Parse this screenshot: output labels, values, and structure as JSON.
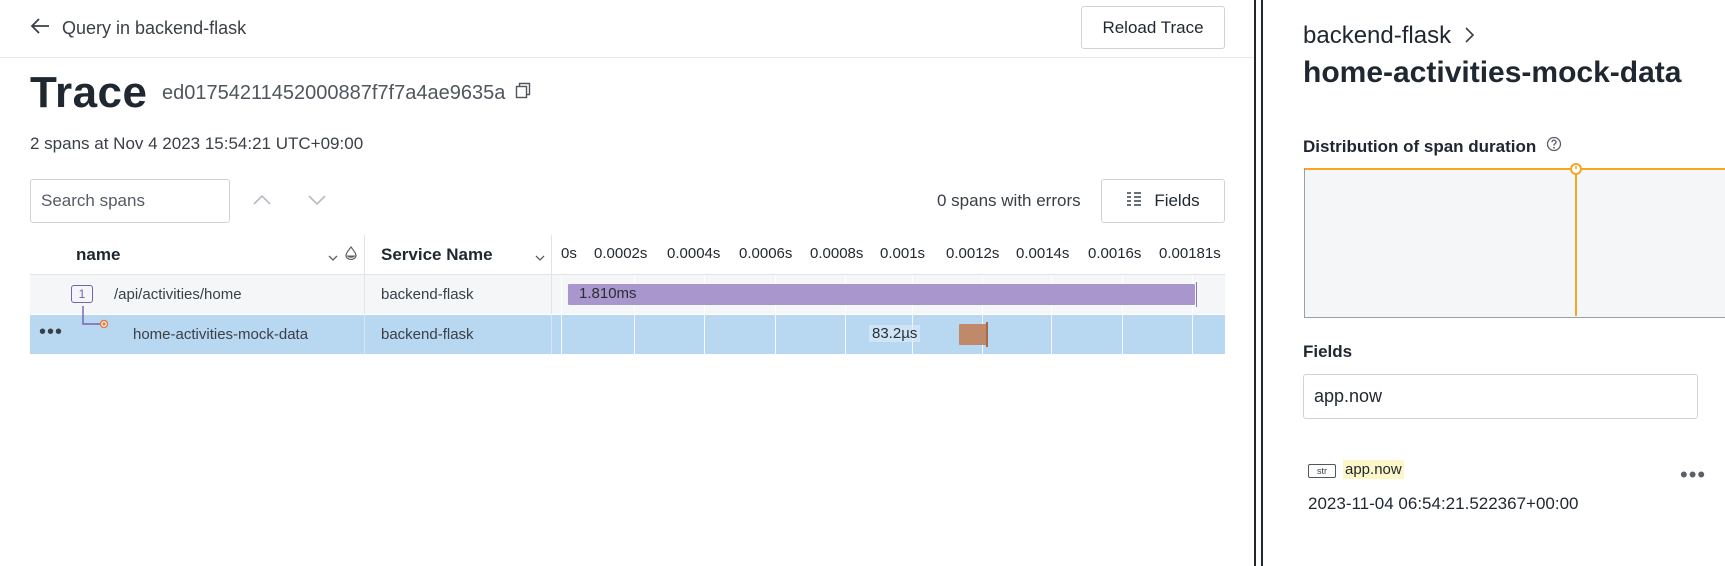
{
  "header": {
    "back_label": "Query in backend-flask",
    "reload_label": "Reload Trace",
    "title": "Trace",
    "trace_id": "ed01754211452000887f7f7a4ae9635a",
    "subtitle": "2 spans at Nov 4 2023 15:54:21 UTC+09:00"
  },
  "toolbar": {
    "search_placeholder": "Search spans",
    "errors_text": "0 spans with errors",
    "fields_label": "Fields"
  },
  "table": {
    "columns": {
      "name": "name",
      "service": "Service Name"
    },
    "ticks": [
      "0s",
      "0.0002s",
      "0.0004s",
      "0.0006s",
      "0.0008s",
      "0.001s",
      "0.0012s",
      "0.0014s",
      "0.0016s",
      "0.00181s"
    ],
    "rows": [
      {
        "child_count": "1",
        "name": "/api/activities/home",
        "service": "backend-flask",
        "duration": "1.810ms",
        "color": "#a896cc"
      },
      {
        "name": "home-activities-mock-data",
        "service": "backend-flask",
        "duration": "83.2µs",
        "color": "#c08a6a"
      }
    ]
  },
  "panel": {
    "service": "backend-flask",
    "span_name": "home-activities-mock-data",
    "distribution_label": "Distribution of span duration",
    "fields_label": "Fields",
    "fields_input_value": "app.now",
    "field": {
      "type": "str",
      "name": "app.now",
      "value": "2023-11-04 06:54:21.522367+00:00"
    },
    "accent": "#f5a623"
  }
}
